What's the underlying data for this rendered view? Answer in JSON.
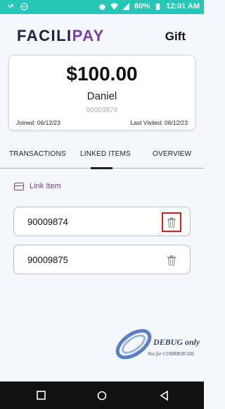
{
  "status_bar": {
    "battery": "80%",
    "time": "12:01 AM"
  },
  "header": {
    "logo_part1": "FACILI",
    "logo_part2": "PAY",
    "page_title": "Gift"
  },
  "card": {
    "amount": "$100.00",
    "name": "Daniel",
    "account": "90009874",
    "joined": "Joined: 06/12/23",
    "last_visited": "Last Visited: 06/12/23"
  },
  "tabs": [
    {
      "label": "TRANSACTIONS"
    },
    {
      "label": "LINKED ITEMS",
      "selected": true
    },
    {
      "label": "OVERVIEW"
    }
  ],
  "link_item": {
    "label": "Link Item"
  },
  "linked_items": [
    {
      "number": "90009874",
      "highlighted": true
    },
    {
      "number": "90009875"
    }
  ],
  "watermark": {
    "word": "DEBUG only",
    "sub": "Not for COMMERCIAL"
  },
  "colors": {
    "accent": "#7a3ea3",
    "status_bar": "#26c7b6",
    "navy": "#1c2340",
    "highlight": "#e01b1b"
  }
}
